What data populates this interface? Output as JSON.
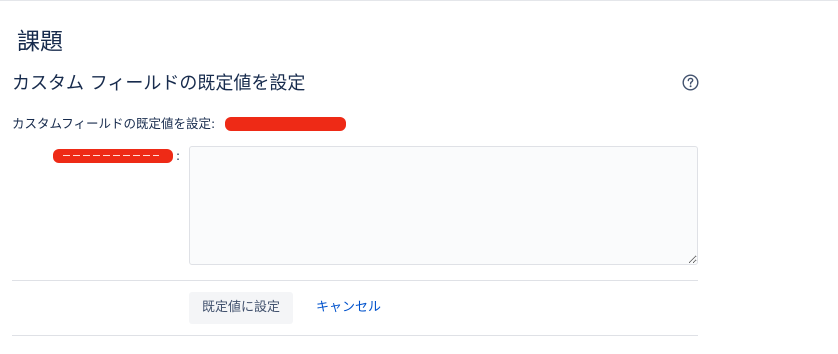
{
  "section": {
    "title": "課題"
  },
  "dialog": {
    "heading": "カスタム フィールドの既定値を設定",
    "help_icon": "question-circle-icon",
    "description_prefix": "カスタムフィールドの既定値を設定:",
    "field_label_suffix": ":",
    "textarea_value": "",
    "set_default_label": "既定値に設定",
    "cancel_label": "キャンセル"
  },
  "colors": {
    "text": "#172b4d",
    "link": "#0052cc",
    "redaction": "#ee2a16",
    "input_bg": "#fafbfc",
    "button_bg": "#f4f5f7"
  }
}
